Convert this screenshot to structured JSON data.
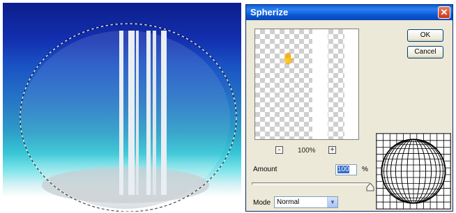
{
  "dialog": {
    "title": "Spherize",
    "close_icon": "close-x-icon",
    "ok_label": "OK",
    "cancel_label": "Cancel",
    "zoom_out_label": "-",
    "zoom_in_label": "+",
    "zoom_level": "100%",
    "amount_label": "Amount",
    "amount_value": "100",
    "amount_unit": "%",
    "amount_slider_fraction": 1.0,
    "mode_label": "Mode",
    "mode_value": "Normal",
    "preview_cursor_icon": "hand-icon",
    "effect_preview_icon": "sphere-grid-icon"
  },
  "colors": {
    "title_bar": "#0a5fd8",
    "dialog_bg": "#ece9d8",
    "selection": "#316ac5",
    "close_button": "#c8381c"
  }
}
